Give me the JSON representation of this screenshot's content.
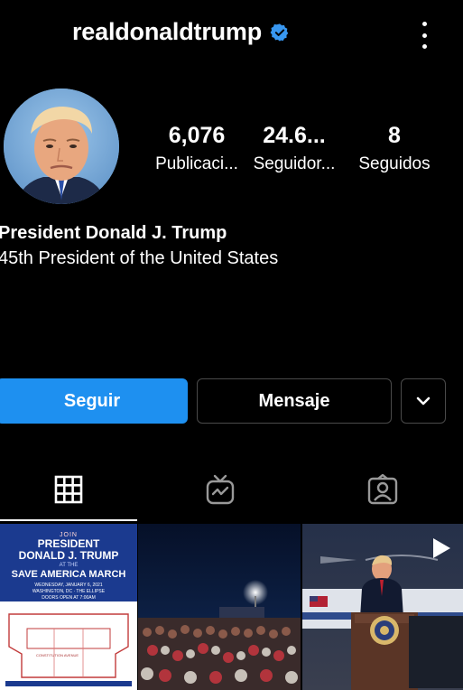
{
  "profile": {
    "username": "realdonaldtrump",
    "verified_icon": "verified-badge-icon",
    "more_icon": "more-vertical-icon"
  },
  "stats": {
    "posts": {
      "value": "6,076",
      "label": "Publicaci..."
    },
    "followers": {
      "value": "24.6...",
      "label": "Seguidor..."
    },
    "following": {
      "value": "8",
      "label": "Seguidos"
    }
  },
  "bio": {
    "name": "President Donald J. Trump",
    "text": "45th President of the United States"
  },
  "actions": {
    "follow_label": "Seguir",
    "message_label": "Mensaje",
    "more_icon": "chevron-down-icon"
  },
  "tabs": [
    {
      "icon": "grid-icon",
      "active": true
    },
    {
      "icon": "igtv-icon",
      "active": false
    },
    {
      "icon": "tagged-icon",
      "active": false
    }
  ],
  "posts": [
    {
      "type": "image",
      "poster": {
        "join": "JOIN",
        "line1": "PRESIDENT",
        "line2": "DONALD J. TRUMP",
        "at": "AT THE",
        "event": "SAVE AMERICA MARCH",
        "date": "WEDNESDAY, JANUARY 6, 2021",
        "place": "WASHINGTON, DC · THE ELLIPSE",
        "doors": "DOORS OPEN AT 7:00AM",
        "map_label": "CONSTITUTION AVENUE"
      }
    },
    {
      "type": "image",
      "description_icon": "rally-photo"
    },
    {
      "type": "video",
      "play_icon": "play-icon"
    }
  ],
  "colors": {
    "background": "#000000",
    "follow_button": "#1e90f0",
    "verified": "#3897f0",
    "border": "#4a4a4a"
  }
}
